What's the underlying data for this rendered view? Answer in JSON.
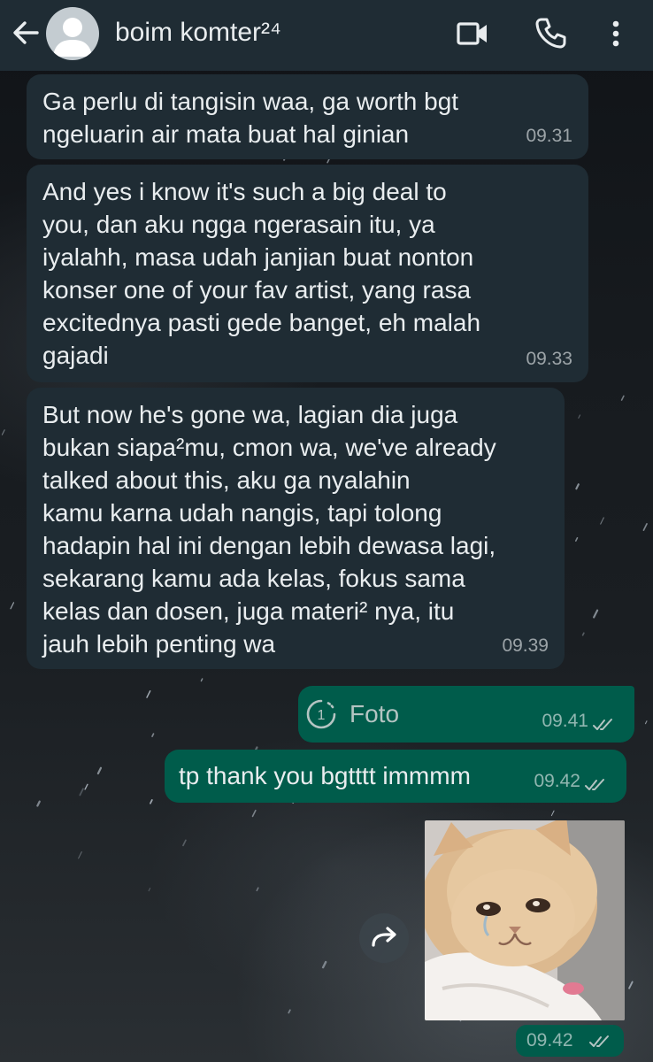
{
  "header": {
    "contact_name": "boim komter²⁴",
    "icons": [
      "back-arrow-icon",
      "avatar-placeholder-icon",
      "video-call-icon",
      "phone-icon",
      "more-vert-icon"
    ]
  },
  "colors": {
    "header_bg": "#1f2c34",
    "incoming_bubble": "#1f2c34",
    "outgoing_bubble": "#005c4b",
    "text": "#e9edef"
  },
  "messages": [
    {
      "direction": "incoming",
      "text": "Ga perlu di tangisin waa, ga worth bgt\nngeluarin air mata buat hal ginian",
      "time": "09.31"
    },
    {
      "direction": "incoming",
      "text": "And yes i know it's such a big deal to\nyou, dan aku ngga ngerasain itu, ya\niyalahh, masa udah janjian buat nonton\nkonser one of your fav artist, yang rasa\nexcitednya pasti gede banget, eh malah\ngajadi",
      "time": "09.33"
    },
    {
      "direction": "incoming",
      "text": "But now he's gone wa, lagian dia juga\nbukan siapa²mu, cmon wa, we've already\ntalked about this, aku ga nyalahin\nkamu karna udah nangis, tapi tolong\nhadapin hal ini dengan lebih dewasa lagi,\nsekarang kamu ada kelas, fokus sama\nkelas dan dosen, juga materi² nya, itu\njauh lebih penting wa",
      "time": "09.39"
    },
    {
      "direction": "outgoing",
      "type": "view-once-photo",
      "label": "Foto",
      "view_once_count": "1",
      "time": "09.41",
      "status": "read"
    },
    {
      "direction": "outgoing",
      "text": "tp thank you bgtttt immmm",
      "time": "09.42",
      "status": "read"
    },
    {
      "direction": "outgoing",
      "type": "sticker",
      "sticker": "crying-kitten-sticker",
      "time": "09.42",
      "status": "read"
    }
  ]
}
